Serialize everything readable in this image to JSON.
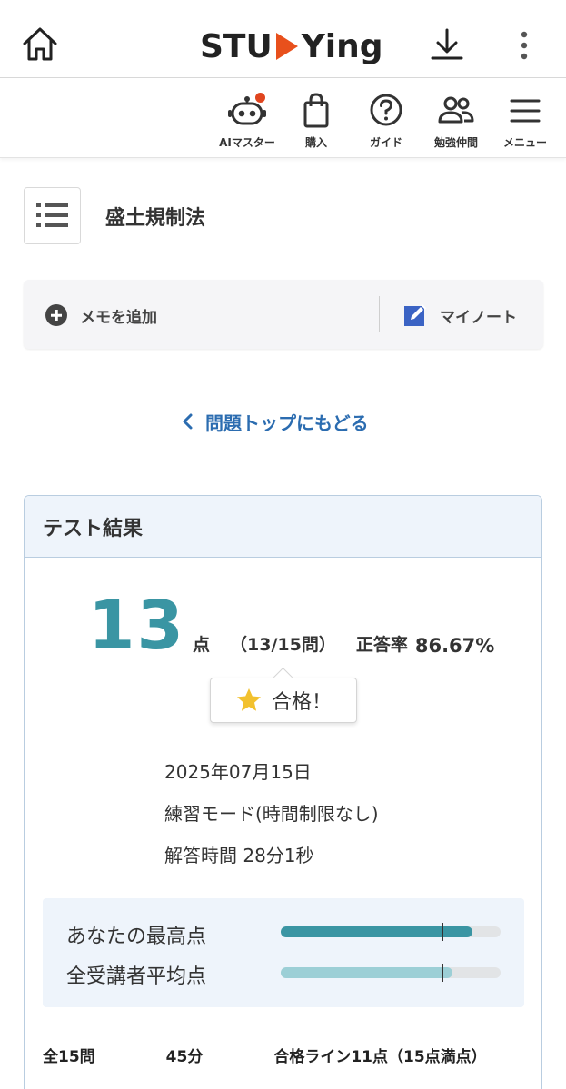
{
  "header": {
    "logo_left": "STU",
    "logo_right": "Ying",
    "brand_color": "#e8501c"
  },
  "toolbar": {
    "items": [
      {
        "label": "AIマスター",
        "icon": "robot-icon",
        "has_notification": true
      },
      {
        "label": "購入",
        "icon": "shopping-bag-icon"
      },
      {
        "label": "ガイド",
        "icon": "question-circle-icon"
      },
      {
        "label": "勉強仲間",
        "icon": "people-icon"
      },
      {
        "label": "メニュー",
        "icon": "hamburger-icon"
      }
    ]
  },
  "page": {
    "title": "盛土規制法"
  },
  "memo": {
    "add_label": "メモを追加",
    "mynote_label": "マイノート"
  },
  "back_link": "問題トップにもどる",
  "result": {
    "heading": "テスト結果",
    "score": "13",
    "score_unit": "点",
    "count": "（13/15問）",
    "rate_label": "正答率",
    "rate": "86.67%",
    "pass_label": "合格！",
    "date": "2025年07月15日",
    "mode": "練習モード(時間制限なし)",
    "answer_time": "解答時間 28分1秒",
    "comparison": [
      {
        "label": "あなたの最高点",
        "value": 0.87,
        "color": "#3a95a3"
      },
      {
        "label": "全受講者平均点",
        "value": 0.78,
        "color": "#9ccfd6"
      }
    ],
    "pass_line_fraction": 0.733,
    "footer": {
      "questions": "全15問",
      "time_limit": "45分",
      "pass_line": "合格ライン11点（15点満点）"
    }
  }
}
